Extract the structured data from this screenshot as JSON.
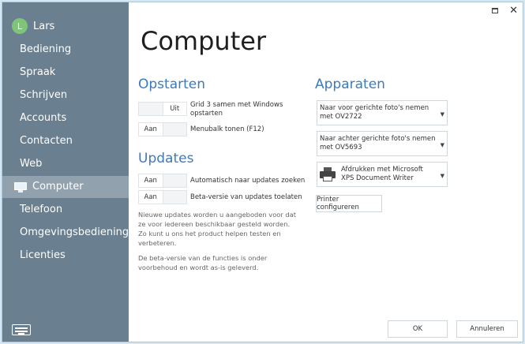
{
  "user": {
    "initial": "L",
    "name": "Lars"
  },
  "nav": {
    "items": [
      {
        "label": "Bediening"
      },
      {
        "label": "Spraak"
      },
      {
        "label": "Schrijven"
      },
      {
        "label": "Accounts"
      },
      {
        "label": "Contacten"
      },
      {
        "label": "Web"
      },
      {
        "label": "Computer",
        "active": true,
        "icon": "monitor-icon"
      },
      {
        "label": "Telefoon"
      },
      {
        "label": "Omgevingsbediening"
      },
      {
        "label": "Licenties"
      }
    ]
  },
  "window_controls": {
    "restore_icon": "restore-icon",
    "close_glyph": "✕"
  },
  "page_title": "Computer",
  "startup": {
    "title": "Opstarten",
    "options": [
      {
        "on": "",
        "off": "Uit",
        "label": "Grid 3 samen met Windows opstarten"
      },
      {
        "on": "Aan",
        "off": "",
        "label": "Menubalk tonen (F12)"
      }
    ]
  },
  "updates": {
    "title": "Updates",
    "options": [
      {
        "on": "Aan",
        "off": "",
        "label": "Automatisch naar updates zoeken"
      },
      {
        "on": "Aan",
        "off": "",
        "label": "Beta-versie van updates toelaten"
      }
    ],
    "info1": "Nieuwe updates worden u aangeboden voor dat ze voor iedereen beschikbaar gesteld worden. Zo kunt u ons het product helpen testen en verbeteren.",
    "info2": "De beta-versie van de functies is onder voorbehoud en wordt as-is geleverd."
  },
  "devices": {
    "title": "Apparaten",
    "front_camera": "Naar voor gerichte foto's nemen met OV2722",
    "rear_camera": "Naar achter gerichte foto's nemen met OV5693",
    "printer": "Afdrukken met Microsoft XPS Document Writer",
    "configure_printer": "Printer configureren"
  },
  "footer": {
    "ok": "OK",
    "cancel": "Annuleren"
  },
  "colors": {
    "sidebar": "#6a7f8f",
    "sidebar_active": "#91a1ae",
    "accent": "#3d7ab8",
    "avatar": "#7ec57a"
  }
}
